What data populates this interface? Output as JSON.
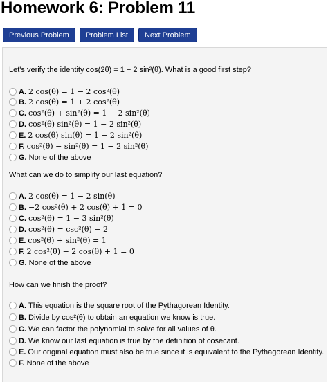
{
  "title": "Homework 6: Problem 11",
  "nav": [
    "Previous Problem",
    "Problem List",
    "Next Problem"
  ],
  "questions": [
    {
      "prompt": "Let's verify the identity cos(2θ) = 1 − 2 sin²(θ). What is a good first step?",
      "options": [
        {
          "letter": "A.",
          "text": "2 cos(θ) = 1 − 2 cos²(θ)",
          "math": true
        },
        {
          "letter": "B.",
          "text": "2 cos(θ) = 1 + 2 cos²(θ)",
          "math": true
        },
        {
          "letter": "C.",
          "text": "cos²(θ) + sin²(θ) = 1 − 2 sin²(θ)",
          "math": true
        },
        {
          "letter": "D.",
          "text": "cos²(θ) sin²(θ) = 1 − 2 sin²(θ)",
          "math": true
        },
        {
          "letter": "E.",
          "text": "2 cos(θ) sin(θ) = 1 − 2 sin²(θ)",
          "math": true
        },
        {
          "letter": "F.",
          "text": "cos²(θ) − sin²(θ) = 1 − 2 sin²(θ)",
          "math": true
        },
        {
          "letter": "G.",
          "text": "None of the above",
          "math": false
        }
      ]
    },
    {
      "prompt": "What can we do to simplify our last equation?",
      "options": [
        {
          "letter": "A.",
          "text": "2 cos(θ) = 1 − 2 sin(θ)",
          "math": true
        },
        {
          "letter": "B.",
          "text": "−2 cos²(θ) + 2 cos(θ) + 1 = 0",
          "math": true
        },
        {
          "letter": "C.",
          "text": "cos²(θ) = 1 − 3 sin²(θ)",
          "math": true
        },
        {
          "letter": "D.",
          "text": "cos²(θ) = csc²(θ) − 2",
          "math": true
        },
        {
          "letter": "E.",
          "text": "cos²(θ) + sin²(θ) = 1",
          "math": true
        },
        {
          "letter": "F.",
          "text": "2 cos²(θ) − 2 cos(θ) + 1 = 0",
          "math": true
        },
        {
          "letter": "G.",
          "text": "None of the above",
          "math": false
        }
      ]
    },
    {
      "prompt": "How can we finish the proof?",
      "options": [
        {
          "letter": "A.",
          "text": "This equation is the square root of the Pythagorean Identity.",
          "math": false
        },
        {
          "letter": "B.",
          "text": "Divide by cos²(θ) to obtain an equation we know is true.",
          "math": false
        },
        {
          "letter": "C.",
          "text": "We can factor the polynomial to solve for all values of θ.",
          "math": false
        },
        {
          "letter": "D.",
          "text": "We know our last equation is true by the definition of cosecant.",
          "math": false
        },
        {
          "letter": "E.",
          "text": "Our original equation must also be true since it is equivalent to the Pythagorean Identity.",
          "math": false
        },
        {
          "letter": "F.",
          "text": "None of the above",
          "math": false
        }
      ]
    }
  ]
}
